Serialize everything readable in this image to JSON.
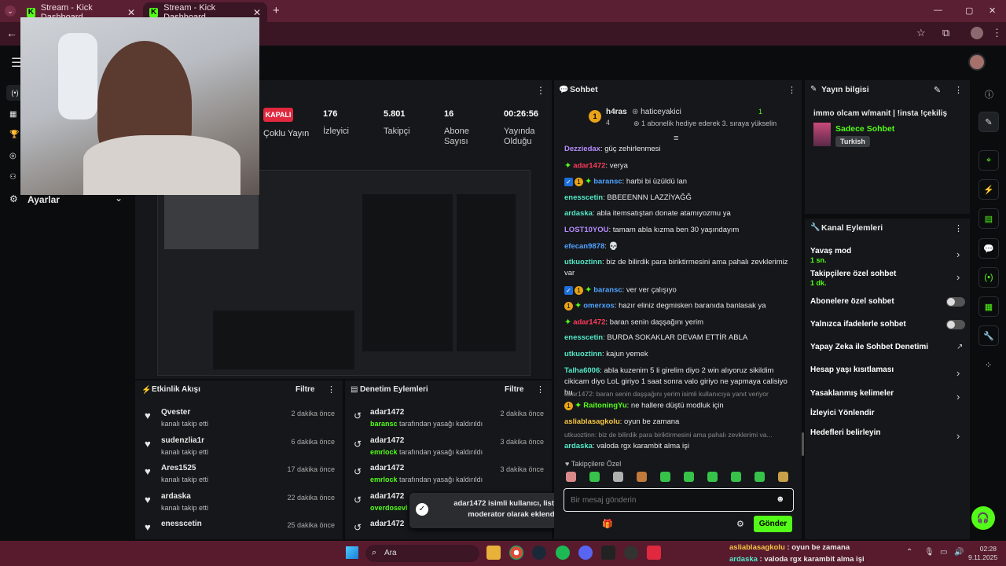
{
  "browser": {
    "tabs": [
      {
        "title": "Stream - Kick Dashboard"
      },
      {
        "title": "Stream - Kick Dashboard"
      }
    ],
    "new_tab": "+",
    "window_controls": [
      "—",
      "▢",
      "✕"
    ]
  },
  "left_nav": {
    "settings_label": "Ayarlar"
  },
  "stream": {
    "status": "KAPALI",
    "mode": "Çoklu Yayın",
    "stats": [
      {
        "value": "176",
        "label": "İzleyici"
      },
      {
        "value": "5.801",
        "label": "Takipçi"
      },
      {
        "value": "16",
        "label": "Abone Sayısı"
      },
      {
        "value": "00:26:56",
        "label": "Yayında Olduğu"
      }
    ]
  },
  "chat": {
    "title": "Sohbet",
    "pinned": {
      "user1": "h4ras",
      "count": "4",
      "user2": "haticeyakici",
      "count2": "1",
      "note": "1 abonelik hediye ederek 3. sıraya yükselin"
    },
    "messages": [
      {
        "user": "Dezziedax",
        "color": "#b68cff",
        "text": ": güç zehirlenmesi",
        "badges": ""
      },
      {
        "user": "adar1472",
        "color": "#ff3b5c",
        "text": ": verya",
        "badges": "s"
      },
      {
        "user": "baransc",
        "color": "#4fa3ff",
        "text": ": harbi bi üzüldü lan",
        "badges": "vbs"
      },
      {
        "user": "enesscetin",
        "color": "#53e8c8",
        "text": ": BBEEENNN LAZZİYAĞĞ",
        "badges": ""
      },
      {
        "user": "ardaska",
        "color": "#53e8c8",
        "text": ": abla itemsatıştan donate atamıyozmu ya",
        "badges": ""
      },
      {
        "user": "LOST10YOU",
        "color": "#b68cff",
        "text": ": tamam abla kızma ben 30 yaşındayım",
        "badges": ""
      },
      {
        "user": "efecan9878",
        "color": "#4fa3ff",
        "text": ": 💀",
        "badges": ""
      },
      {
        "user": "utkuoztinn",
        "color": "#53e8c8",
        "text": ": biz de bilirdik para biriktirmesini ama pahalı zevklerimiz var",
        "badges": ""
      },
      {
        "user": "baransc",
        "color": "#4fa3ff",
        "text": ": ver ver çalışıyo",
        "badges": "vbs"
      },
      {
        "user": "omerxos",
        "color": "#4fa3ff",
        "text": ": hazır eliniz degmisken baranıda banlasak ya",
        "badges": "bs"
      },
      {
        "user": "adar1472",
        "color": "#ff3b5c",
        "text": ": baran senin daşşağını yerim",
        "badges": "s"
      },
      {
        "user": "enesscetin",
        "color": "#53e8c8",
        "text": ": BURDA SOKAKLAR DEVAM ETTİR ABLA",
        "badges": ""
      },
      {
        "user": "utkuoztinn",
        "color": "#53e8c8",
        "text": ": kajun yemek",
        "badges": ""
      },
      {
        "user": "Talha6006",
        "color": "#53e8c8",
        "text": ": abla kuzenim 5 li girelim diyo 2 win alıyoruz sikildim cikicam diyo LoL giriyo 1 saat sonra valo giriyo ne yapmaya calisiyo bu",
        "badges": ""
      },
      {
        "user": "RaitoningYu",
        "color": "#53fc18",
        "text": ": ne hallere düştü modluk için",
        "badges": "bs",
        "reply": "adar1472: baran senin daşşağını yerim isimli kullanıcıya yanıt veriyor"
      },
      {
        "user": "asliablasagkolu",
        "color": "#f5c542",
        "text": ": oyun be zamana",
        "badges": ""
      },
      {
        "user": "ardaska",
        "color": "#53e8c8",
        "text": ": valoda rgx karambit alma işi",
        "badges": "",
        "reply": "utkuoztinn: biz de bilirdik para biriktirmesini ama pahalı zevklerimi va..."
      }
    ],
    "followers_only": "Takipçilere Özel",
    "input_placeholder": "Bir mesaj gönderin",
    "send": "Gönder"
  },
  "toast": {
    "text": "adar1472 isimli kullanıcı, listenize moderator olarak eklendi."
  },
  "activity": {
    "title": "Etkinlik Akışı",
    "filter": "Filtre",
    "items": [
      {
        "name": "Qvester",
        "action": "kanalı takip etti",
        "time": "2 dakika önce"
      },
      {
        "name": "sudenzlia1r",
        "action": "kanalı takip etti",
        "time": "6 dakika önce"
      },
      {
        "name": "Ares1525",
        "action": "kanalı takip etti",
        "time": "17 dakika önce"
      },
      {
        "name": "ardaska",
        "action": "kanalı takip etti",
        "time": "22 dakika önce"
      },
      {
        "name": "enesscetin",
        "action": "",
        "time": "25 dakika önce"
      }
    ]
  },
  "moderation": {
    "title": "Denetim Eylemleri",
    "filter": "Filtre",
    "items": [
      {
        "name": "adar1472",
        "by": "baransc",
        "action": " tarafından yasağı kaldırıldı",
        "time": "2 dakika önce"
      },
      {
        "name": "adar1472",
        "by": "emrlock",
        "action": " tarafından yasağı kaldırıldı",
        "time": "3 dakika önce"
      },
      {
        "name": "adar1472",
        "by": "emrlock",
        "action": " tarafından yasağı kaldırıldı",
        "time": "3 dakika önce"
      },
      {
        "name": "adar1472",
        "by": "overdosevl",
        "action": " ta",
        "time": ""
      },
      {
        "name": "adar1472",
        "by": "",
        "action": "",
        "time": ""
      }
    ]
  },
  "stream_info": {
    "title": "Yayın bilgisi",
    "stream_title": "immo olcam w/manit | !insta !çekiliş",
    "category": "Sadece Sohbet",
    "tag": "Turkish"
  },
  "channel_actions": {
    "title": "Kanal Eylemleri",
    "items": [
      {
        "label": "Yavaş mod",
        "sub": "1 sn.",
        "ctrl": "chev"
      },
      {
        "label": "Takipçilere özel sohbet",
        "sub": "1 dk.",
        "ctrl": "chev"
      },
      {
        "label": "Abonelere özel sohbet",
        "sub": "",
        "ctrl": "toggle"
      },
      {
        "label": "Yalnızca ifadelerle sohbet",
        "sub": "",
        "ctrl": "toggle"
      },
      {
        "label": "Yapay Zeka ile Sohbet Denetimi",
        "sub": "",
        "ctrl": "ext"
      },
      {
        "label": "Hesap yaşı kısıtlaması",
        "sub": "",
        "ctrl": "chev"
      },
      {
        "label": "Yasaklanmış kelimeler",
        "sub": "",
        "ctrl": "chev"
      },
      {
        "label": "İzleyici Yönlendir",
        "sub": "",
        "ctrl": ""
      },
      {
        "label": "Hedefleri belirleyin",
        "sub": "",
        "ctrl": "chev"
      }
    ]
  },
  "taskbar": {
    "search": "Ara",
    "overlay_lines": [
      {
        "user": "asliablasagkolu",
        "text": " : oyun be zamana"
      },
      {
        "user": "ardaska",
        "text": " : valoda rgx karambit alma işi"
      }
    ],
    "time": "02:28",
    "date": "9.11.2025"
  },
  "colors": {
    "accent": "#53fc18",
    "titlebar": "#5a1f33",
    "panel": "#15171a",
    "live_off": "#e0283f"
  }
}
